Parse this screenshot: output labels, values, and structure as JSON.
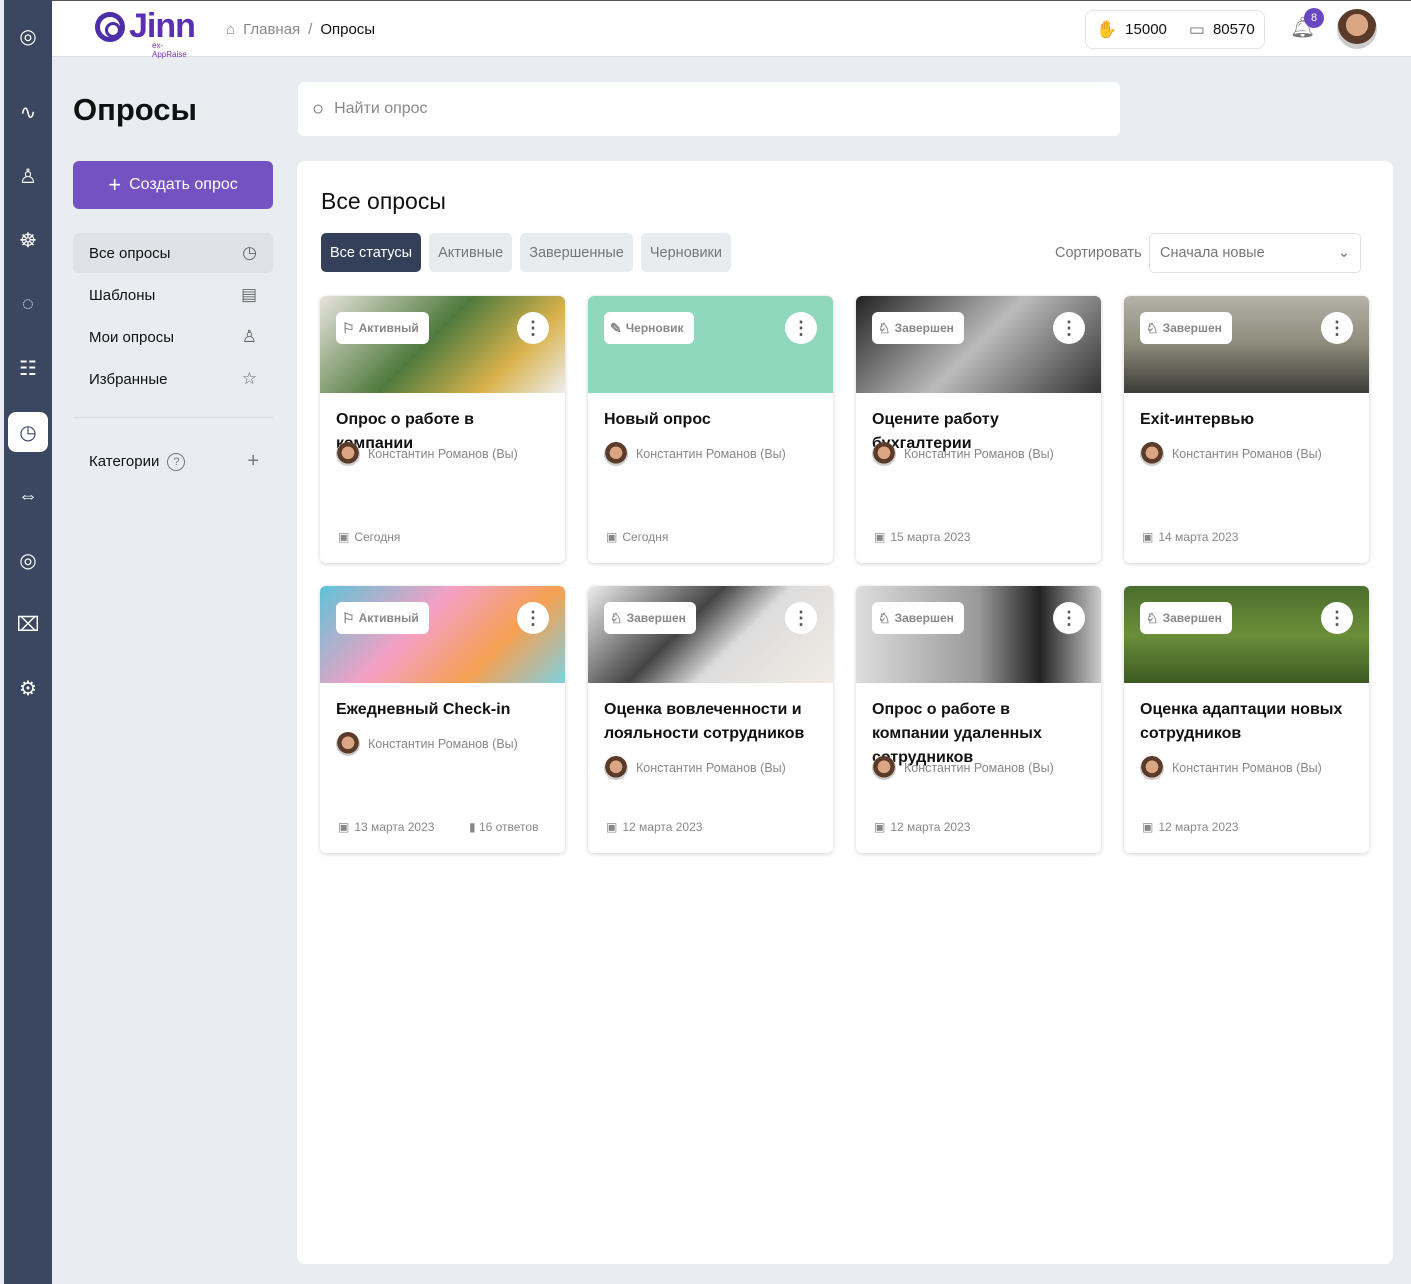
{
  "header": {
    "logo": "Jinn",
    "logo_sub": "ex-AppRaise",
    "breadcrumb": [
      "Главная",
      "Опросы"
    ],
    "claps": "15000",
    "wallet": "80570",
    "notifications": "8"
  },
  "page": {
    "title": "Опросы",
    "create_label": "Создать опрос",
    "search_placeholder": "Найти опрос"
  },
  "nav": [
    {
      "label": "Все опросы",
      "icon": "◷"
    },
    {
      "label": "Шаблоны",
      "icon": "▤"
    },
    {
      "label": "Мои опросы",
      "icon": "♙"
    },
    {
      "label": "Избранные",
      "icon": "☆"
    }
  ],
  "categories": {
    "label": "Категории"
  },
  "main": {
    "title": "Все опросы",
    "filters": [
      "Все статусы",
      "Активные",
      "Завершенные",
      "Черновики"
    ],
    "sort_label": "Сортировать",
    "sort_value": "Сначала новые"
  },
  "cards": [
    {
      "status": "Активный",
      "icon": "⚐",
      "title": "Опрос о работе в компании",
      "author": "Константин Романов (Вы)",
      "date": "Сегодня",
      "bg": "linear-gradient(135deg,#e8e4dc,#4f7a3e 45%,#d9b24c 75%,#eee)"
    },
    {
      "status": "Черновик",
      "icon": "✎",
      "title": "Новый опрос",
      "author": "Константин Романов (Вы)",
      "date": "Сегодня",
      "bg": "#8fd8bd"
    },
    {
      "status": "Завершен",
      "icon": "♘",
      "title": "Оцените работу бухгалтерии",
      "author": "Константин Романов (Вы)",
      "date": "15 марта 2023",
      "bg": "linear-gradient(135deg,#222,#bbb 50%,#333)"
    },
    {
      "status": "Завершен",
      "icon": "♘",
      "title": "Exit-интервью",
      "author": "Константин Романов (Вы)",
      "date": "14 марта 2023",
      "bg": "linear-gradient(180deg,#b5b3a8,#8c8a7a 50%,#3b3c38)"
    },
    {
      "status": "Активный",
      "icon": "⚐",
      "title": "Ежедневный Check-in",
      "author": "Константин Романов (Вы)",
      "date": "13 марта 2023",
      "answers": "16 ответов",
      "bg": "linear-gradient(135deg,#5ec3d8,#f4a0c4 40%,#f5a052 70%,#7fd0e0)"
    },
    {
      "status": "Завершен",
      "icon": "♘",
      "title": "Оценка вовлеченности и лояльности сотрудников",
      "author": "Константин Романов (Вы)",
      "date": "12 марта 2023",
      "bg": "linear-gradient(135deg,#eee,#444 40%,#ddd 60%,#f0ece4)"
    },
    {
      "status": "Завершен",
      "icon": "♘",
      "title": "Опрос о работе в компании удаленных сотрудников",
      "author": "Константин Романов (Вы)",
      "date": "12 марта 2023",
      "bg": "linear-gradient(90deg,#ddd,#999 50%,#222 75%,#ccc)"
    },
    {
      "status": "Завершен",
      "icon": "♘",
      "title": "Оценка адаптации новых сотрудников",
      "author": "Константин Романов (Вы)",
      "date": "12 марта 2023",
      "bg": "linear-gradient(180deg,#4a6e2c,#6b8e3a 50%,#3c5a22)"
    }
  ]
}
